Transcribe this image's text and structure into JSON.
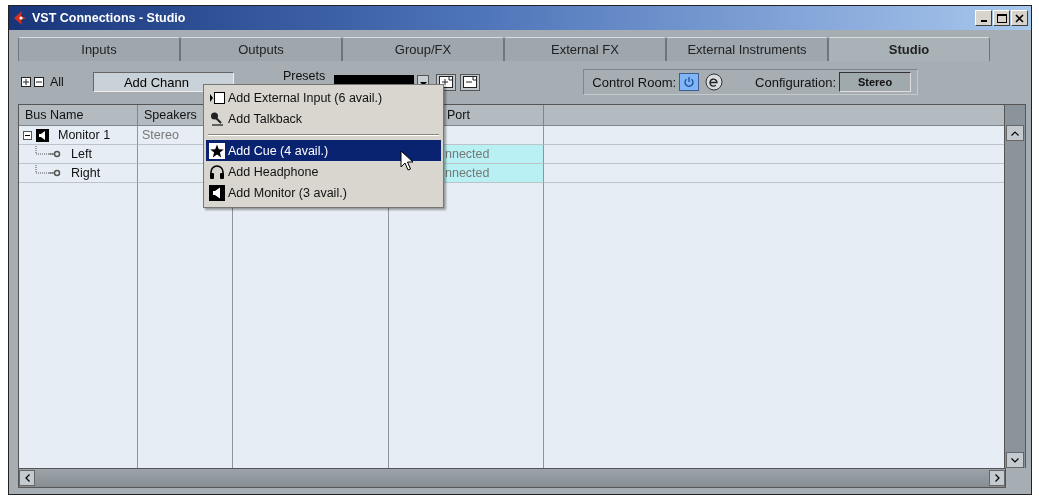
{
  "window": {
    "title": "VST Connections - Studio"
  },
  "tabs": [
    {
      "label": "Inputs",
      "selected": false
    },
    {
      "label": "Outputs",
      "selected": false
    },
    {
      "label": "Group/FX",
      "selected": false
    },
    {
      "label": "External FX",
      "selected": false
    },
    {
      "label": "External Instruments",
      "selected": false
    },
    {
      "label": "Studio",
      "selected": true
    }
  ],
  "toolbar": {
    "expand_all_label": "All",
    "add_button": "Add Chann",
    "presets_label": "Presets",
    "control_room_label": "Control Room:",
    "control_room_on": true,
    "configuration_label": "Configuration:",
    "configuration_value": "Stereo"
  },
  "table": {
    "columns": [
      "Bus Name",
      "Speakers",
      null,
      "Port"
    ],
    "rows": [
      {
        "bus_name": "Monitor 1",
        "speakers": "Stereo",
        "expanded": true,
        "children": [
          {
            "bus_name": "Left",
            "port": "nnected"
          },
          {
            "bus_name": "Right",
            "port": "nnected"
          }
        ]
      }
    ]
  },
  "menu": {
    "items": [
      {
        "kind": "external-input",
        "label": "Add External Input (6 avail.)",
        "selected": false
      },
      {
        "kind": "talkback",
        "label": "Add Talkback",
        "selected": false
      },
      {
        "kind": "separator"
      },
      {
        "kind": "cue",
        "label": "Add Cue (4 avail.)",
        "selected": true
      },
      {
        "kind": "headphone",
        "label": "Add Headphone",
        "selected": false
      },
      {
        "kind": "monitor",
        "label": "Add Monitor (3 avail.)",
        "selected": false
      }
    ]
  }
}
